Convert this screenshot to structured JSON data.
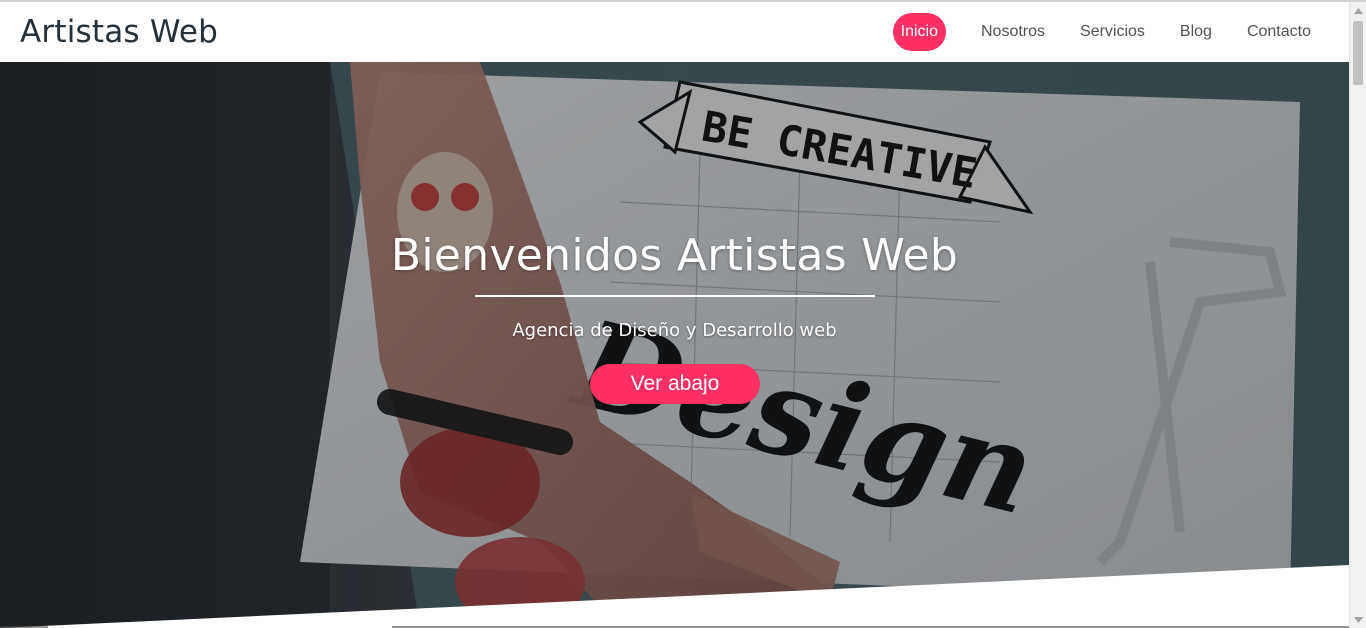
{
  "theme": {
    "accent": "#fd2f63"
  },
  "header": {
    "logo": "Artistas Web",
    "nav": [
      {
        "label": "Inicio",
        "active": true
      },
      {
        "label": "Nosotros",
        "active": false
      },
      {
        "label": "Servicios",
        "active": false
      },
      {
        "label": "Blog",
        "active": false
      },
      {
        "label": "Contacto",
        "active": false
      }
    ]
  },
  "hero": {
    "title": "Bienvenidos Artistas Web",
    "subtitle": "Agencia de Diseño y Desarrollo web",
    "button_label": "Ver abajo",
    "background": {
      "banner_text": "BE CREATIVE",
      "script_text": "Design"
    }
  },
  "scrollbar": {
    "up_icon": "triangle-up-icon",
    "down_icon": "triangle-down-icon"
  }
}
